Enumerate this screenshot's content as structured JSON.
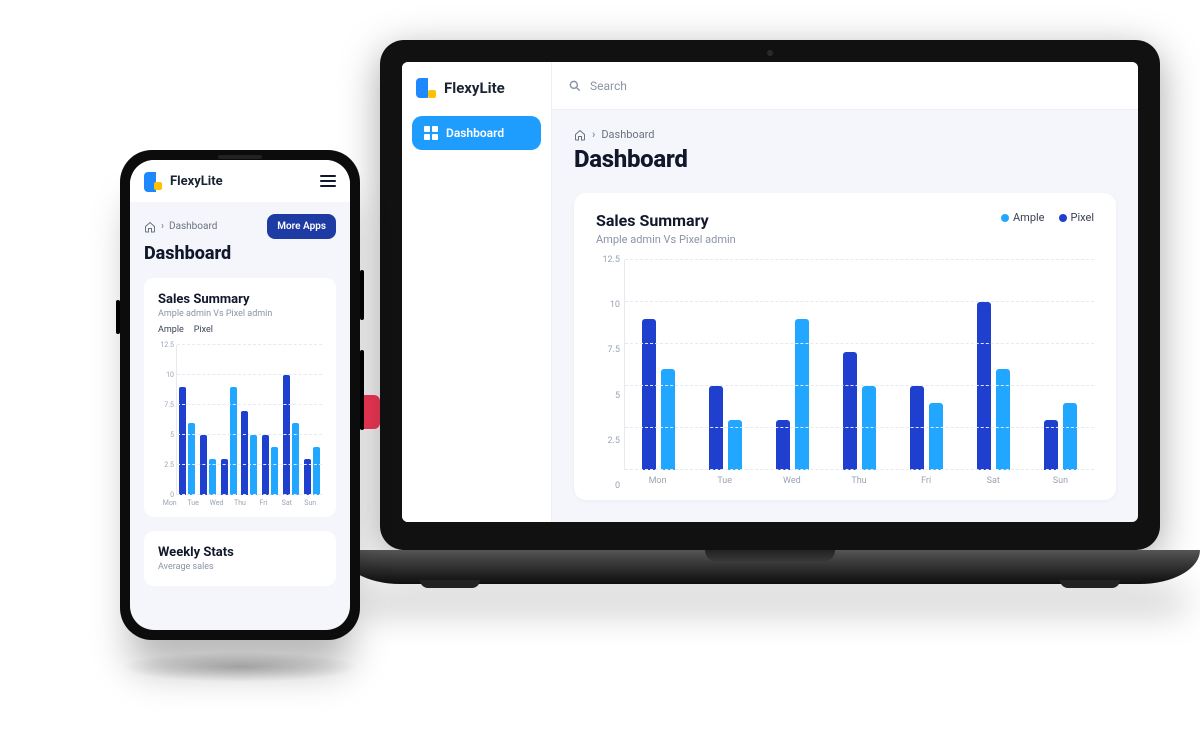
{
  "brand": "FlexyLite",
  "sidebar": {
    "items": [
      {
        "label": "Dashboard"
      }
    ]
  },
  "topbar": {
    "search_placeholder": "Search"
  },
  "breadcrumb": {
    "current": "Dashboard"
  },
  "page_title": "Dashboard",
  "sales_card": {
    "title": "Sales Summary",
    "subtitle": "Ample admin Vs Pixel admin",
    "legend": {
      "ample": "Ample",
      "pixel": "Pixel"
    }
  },
  "mobile": {
    "more_apps": "More Apps",
    "weekly_card": {
      "title": "Weekly Stats",
      "subtitle": "Average sales"
    }
  },
  "chart_data": {
    "type": "bar",
    "title": "Sales Summary",
    "xlabel": "",
    "ylabel": "",
    "ylim": [
      0,
      12.5
    ],
    "yticks": [
      0,
      2.5,
      5,
      7.5,
      10,
      12.5
    ],
    "categories": [
      "Mon",
      "Tue",
      "Wed",
      "Thu",
      "Fri",
      "Sat",
      "Sun"
    ],
    "series": [
      {
        "name": "Pixel",
        "color": "#1f3fcf",
        "values": [
          9,
          5,
          3,
          7,
          5,
          10,
          3
        ]
      },
      {
        "name": "Ample",
        "color": "#21a7ff",
        "values": [
          6,
          3,
          9,
          5,
          4,
          6,
          4
        ]
      }
    ]
  },
  "colors": {
    "accent": "#1e9dff",
    "brand_dark": "#1f3fcf",
    "brand_light": "#21a7ff",
    "danger": "#ff3b5c"
  }
}
